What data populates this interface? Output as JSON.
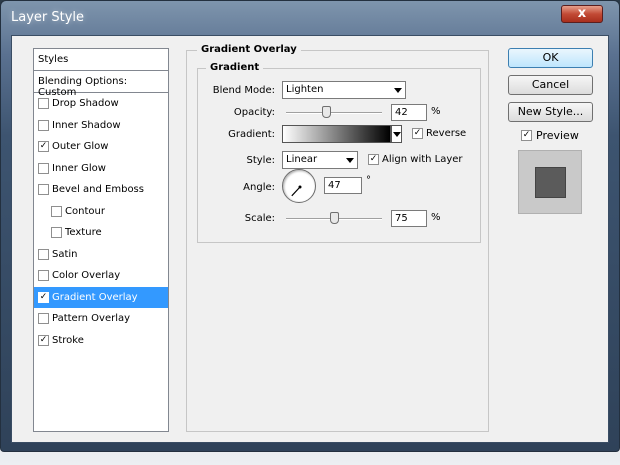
{
  "window": {
    "title": "Layer Style",
    "close_glyph": "x"
  },
  "sidebar": {
    "header": "Styles",
    "blending": "Blending Options: Custom",
    "items": [
      {
        "label": "Drop Shadow",
        "checked": false,
        "sub": false,
        "selected": false
      },
      {
        "label": "Inner Shadow",
        "checked": false,
        "sub": false,
        "selected": false
      },
      {
        "label": "Outer Glow",
        "checked": true,
        "sub": false,
        "selected": false
      },
      {
        "label": "Inner Glow",
        "checked": false,
        "sub": false,
        "selected": false
      },
      {
        "label": "Bevel and Emboss",
        "checked": false,
        "sub": false,
        "selected": false
      },
      {
        "label": "Contour",
        "checked": false,
        "sub": true,
        "selected": false
      },
      {
        "label": "Texture",
        "checked": false,
        "sub": true,
        "selected": false
      },
      {
        "label": "Satin",
        "checked": false,
        "sub": false,
        "selected": false
      },
      {
        "label": "Color Overlay",
        "checked": false,
        "sub": false,
        "selected": false
      },
      {
        "label": "Gradient Overlay",
        "checked": true,
        "sub": false,
        "selected": true
      },
      {
        "label": "Pattern Overlay",
        "checked": false,
        "sub": false,
        "selected": false
      },
      {
        "label": "Stroke",
        "checked": true,
        "sub": false,
        "selected": false
      }
    ]
  },
  "panel": {
    "outer_title": "Gradient Overlay",
    "inner_title": "Gradient",
    "blend_mode": {
      "label": "Blend Mode:",
      "value": "Lighten"
    },
    "opacity": {
      "label": "Opacity:",
      "value": "42",
      "unit": "%",
      "level": 42
    },
    "gradient": {
      "label": "Gradient:",
      "reverse_label": "Reverse",
      "reverse_checked": true
    },
    "style": {
      "label": "Style:",
      "value": "Linear",
      "align_label": "Align with Layer",
      "align_checked": true
    },
    "angle": {
      "label": "Angle:",
      "value": "47",
      "unit": "°",
      "degrees": 47
    },
    "scale": {
      "label": "Scale:",
      "value": "75",
      "unit": "%",
      "level": 50
    }
  },
  "buttons": {
    "ok": "OK",
    "cancel": "Cancel",
    "new_style": "New Style...",
    "preview_label": "Preview",
    "preview_checked": true
  },
  "check_glyph": "✓"
}
